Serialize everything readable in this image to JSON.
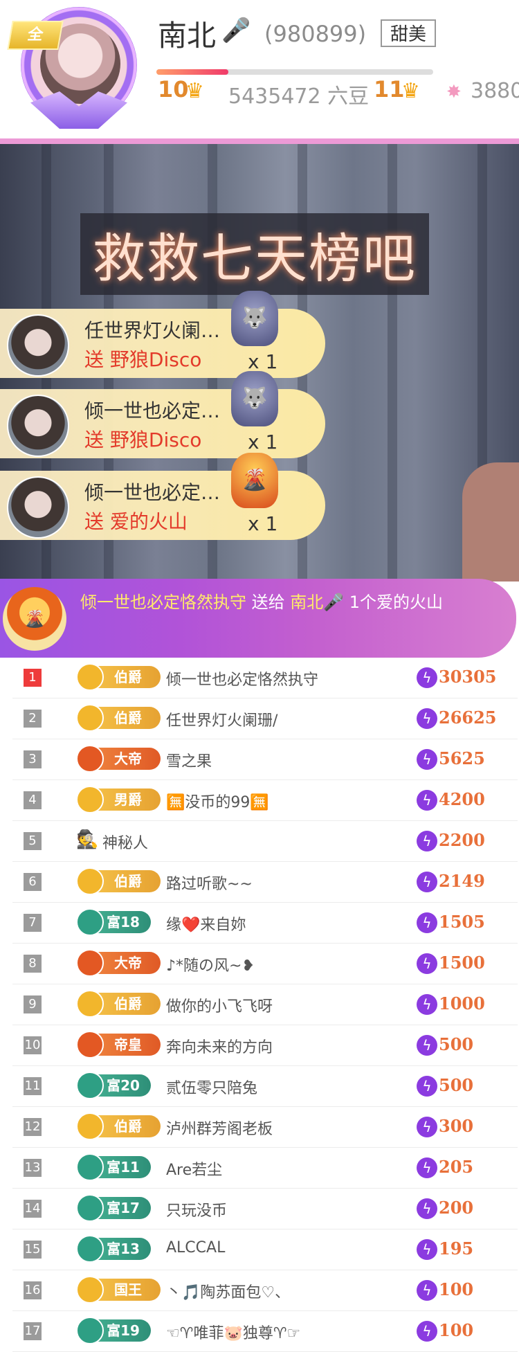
{
  "header": {
    "avatar_tag": "全",
    "name": "南北",
    "room_id": "(980899)",
    "tag": "甜美",
    "level_progress": 0.26,
    "level_left": "10",
    "beans": "5435472 六豆",
    "level_right": "11",
    "fire_value": "3880"
  },
  "video": {
    "caption": "救救七天榜吧"
  },
  "gift_toasts": [
    {
      "user": "任世界灯火阑…",
      "gift": "送 野狼Disco",
      "count": "x 1"
    },
    {
      "user": "倾一世也必定…",
      "gift": "送 野狼Disco",
      "count": "x 1"
    },
    {
      "user": "倾一世也必定…",
      "gift": "送 爱的火山",
      "count": "x 1"
    }
  ],
  "banner": {
    "sender": "倾一世也必定恪然执守",
    "verb": " 送给 ",
    "receiver": "南北",
    "suffix": " 1个爱的火山"
  },
  "ranking": [
    {
      "rank": "1",
      "badge": "伯爵",
      "style": "gold",
      "name": "倾一世也必定恪然执守",
      "value": "30305"
    },
    {
      "rank": "2",
      "badge": "伯爵",
      "style": "gold",
      "name": "任世界灯火阑珊/",
      "value": "26625"
    },
    {
      "rank": "3",
      "badge": "大帝",
      "style": "orange",
      "name": "雪之果",
      "value": "5625"
    },
    {
      "rank": "4",
      "badge": "男爵",
      "style": "gold",
      "name": "🈚没币的99🈚",
      "value": "4200"
    },
    {
      "rank": "5",
      "badge": "",
      "style": "none",
      "name": "神秘人",
      "value": "2200"
    },
    {
      "rank": "6",
      "badge": "伯爵",
      "style": "gold",
      "name": "路过听歌~~",
      "value": "2149"
    },
    {
      "rank": "7",
      "badge": "富18",
      "style": "teal",
      "name": "缘❤️来自妳",
      "value": "1505"
    },
    {
      "rank": "8",
      "badge": "大帝",
      "style": "orange",
      "name": "♪*随の风~❥",
      "value": "1500"
    },
    {
      "rank": "9",
      "badge": "伯爵",
      "style": "gold",
      "name": "做你的小飞飞呀",
      "value": "1000"
    },
    {
      "rank": "10",
      "badge": "帝皇",
      "style": "orange",
      "name": "奔向未来的方向",
      "value": "500"
    },
    {
      "rank": "11",
      "badge": "富20",
      "style": "teal",
      "name": "贰伍零只陪兔",
      "value": "500"
    },
    {
      "rank": "12",
      "badge": "伯爵",
      "style": "gold",
      "name": "泸州群芳阁老板",
      "value": "300"
    },
    {
      "rank": "13",
      "badge": "富11",
      "style": "teal",
      "name": "Are若尘",
      "value": "205"
    },
    {
      "rank": "14",
      "badge": "富17",
      "style": "teal",
      "name": "只玩没币",
      "value": "200"
    },
    {
      "rank": "15",
      "badge": "富13",
      "style": "teal",
      "name": "ALCCAL",
      "value": "195"
    },
    {
      "rank": "16",
      "badge": "国王",
      "style": "gold",
      "name": "丶🎵陶苏面包♡、",
      "value": "100"
    },
    {
      "rank": "17",
      "badge": "富19",
      "style": "teal",
      "name": "☜♈唯菲🐷独尊♈☞",
      "value": "100"
    }
  ]
}
